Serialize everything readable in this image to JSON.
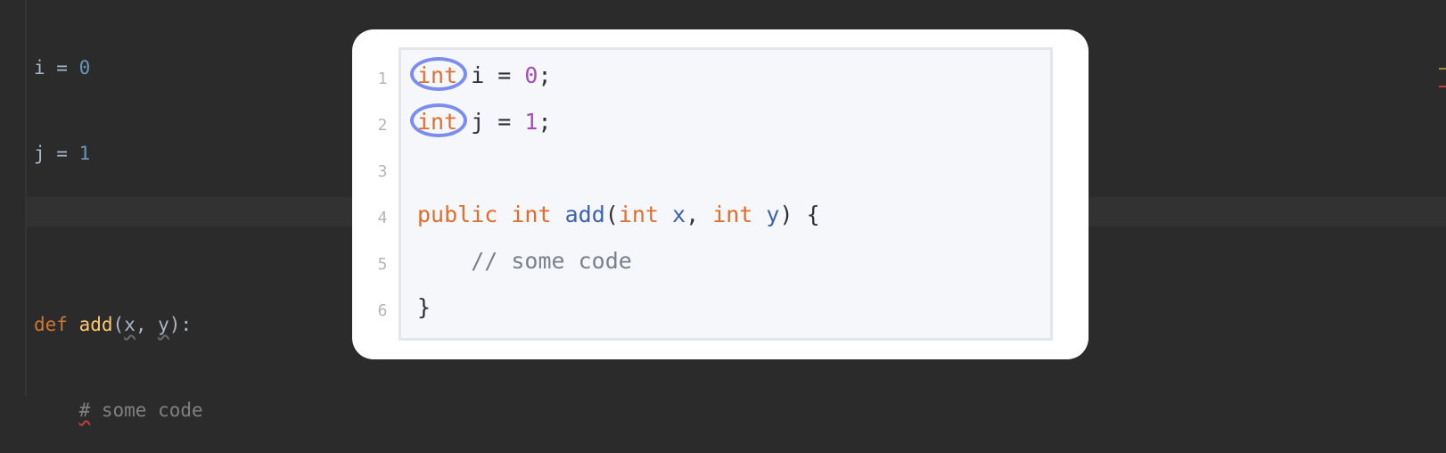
{
  "editor": {
    "lines": [
      {
        "var": "i",
        "eq": " = ",
        "num": "0"
      },
      {
        "var": "j",
        "eq": " = ",
        "num": "1"
      },
      {
        "empty": ""
      },
      {
        "kw": "def",
        "fn": "add",
        "open": "(",
        "p1": "x",
        "sep": ", ",
        "p2": "y",
        "close": "):"
      },
      {
        "indent": "    ",
        "hash": "#",
        "comment": " some code"
      }
    ]
  },
  "card": {
    "lines": [
      {
        "no": "1",
        "kw": "int",
        "rest_a": " i = ",
        "num": "0",
        "rest_b": ";"
      },
      {
        "no": "2",
        "kw": "int",
        "rest_a": " j = ",
        "num": "1",
        "rest_b": ";"
      },
      {
        "no": "3"
      },
      {
        "no": "4",
        "mod": "public",
        "sp1": " ",
        "ret": "int",
        "sp2": " ",
        "fn": "add",
        "open": "(",
        "t1": "int",
        "sp3": " ",
        "p1": "x",
        "sep": ", ",
        "t2": "int",
        "sp4": " ",
        "p2": "y",
        "close": ") {"
      },
      {
        "no": "5",
        "comment": "    // some code"
      },
      {
        "no": "6",
        "brace": "}"
      }
    ]
  },
  "colors": {
    "editor_bg": "#2b2b2b",
    "card_bg": "#ffffff",
    "code_bg": "#f5f7fa",
    "highlight_ring": "#7c8df0",
    "java_keyword": "#e26e2e",
    "java_number": "#a64dbb",
    "java_function": "#3b63b1"
  }
}
